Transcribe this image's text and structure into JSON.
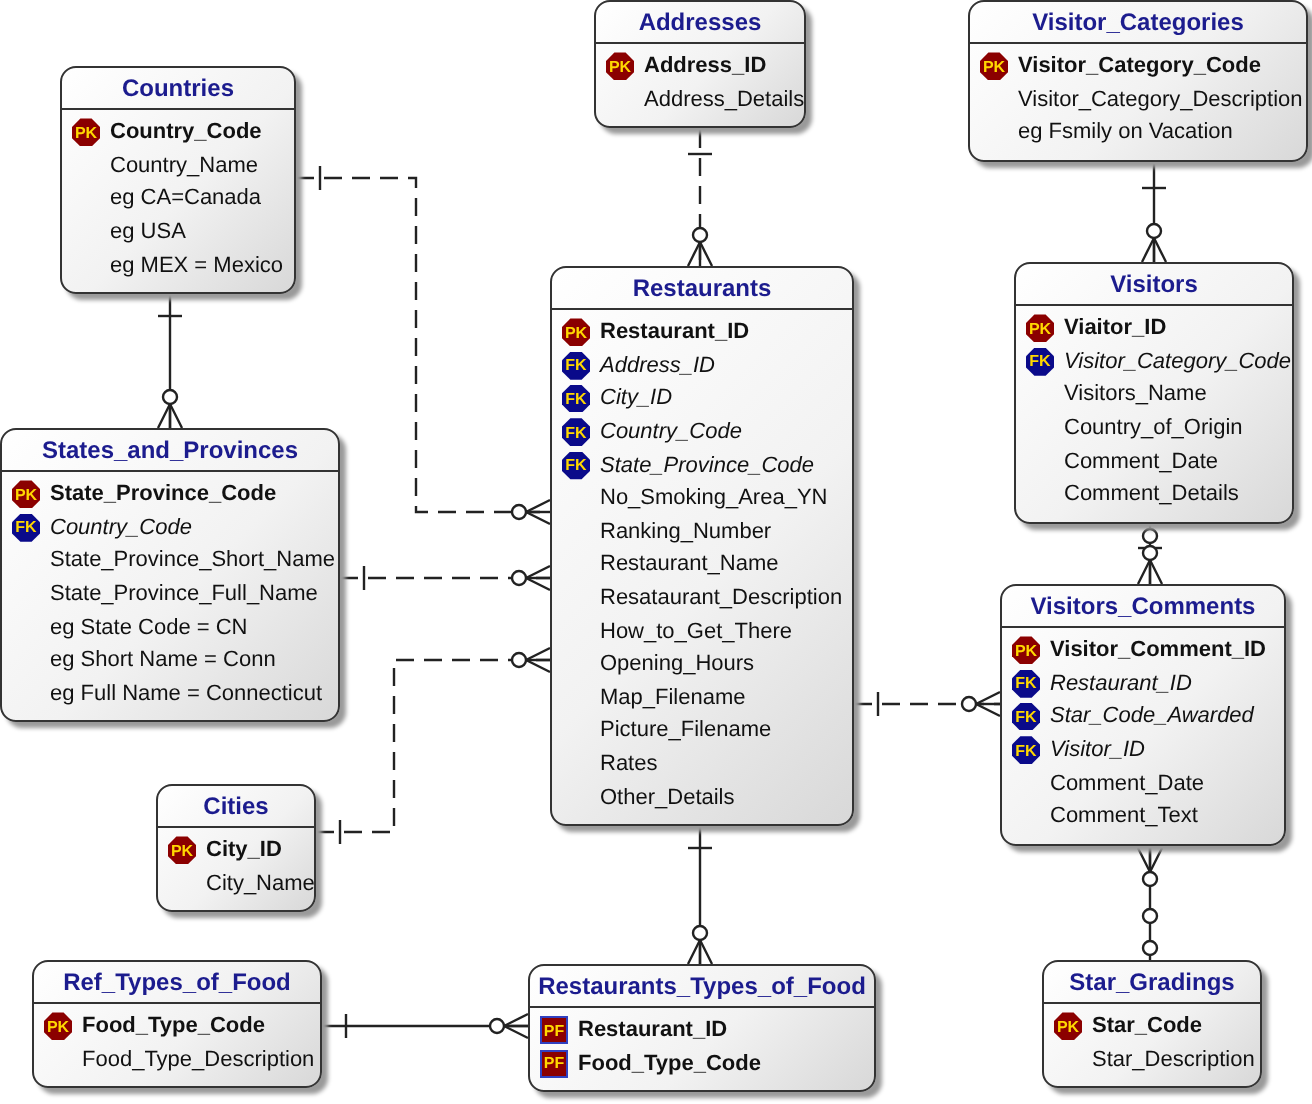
{
  "entities": [
    {
      "name": "Addresses",
      "fields": [
        {
          "name": "Address_ID",
          "kind": "primary",
          "badge": "PK"
        },
        {
          "name": "Address_Details",
          "kind": "plain"
        }
      ]
    },
    {
      "name": "Visitor_Categories",
      "fields": [
        {
          "name": "Visitor_Category_Code",
          "kind": "primary",
          "badge": "PK"
        },
        {
          "name": "Visitor_Category_Description",
          "kind": "plain"
        },
        {
          "name": "eg Fsmily on Vacation",
          "kind": "plain"
        }
      ]
    },
    {
      "name": "Countries",
      "fields": [
        {
          "name": "Country_Code",
          "kind": "primary",
          "badge": "PK"
        },
        {
          "name": "Country_Name",
          "kind": "plain"
        },
        {
          "name": "eg CA=Canada",
          "kind": "plain"
        },
        {
          "name": "eg USA",
          "kind": "plain"
        },
        {
          "name": "eg MEX = Mexico",
          "kind": "plain"
        }
      ]
    },
    {
      "name": "Restaurants",
      "fields": [
        {
          "name": "Restaurant_ID",
          "kind": "primary",
          "badge": "PK"
        },
        {
          "name": "Address_ID",
          "kind": "foreign",
          "badge": "FK"
        },
        {
          "name": "City_ID",
          "kind": "foreign",
          "badge": "FK"
        },
        {
          "name": "Country_Code",
          "kind": "foreign",
          "badge": "FK"
        },
        {
          "name": "State_Province_Code",
          "kind": "foreign",
          "badge": "FK"
        },
        {
          "name": "No_Smoking_Area_YN",
          "kind": "plain"
        },
        {
          "name": "Ranking_Number",
          "kind": "plain"
        },
        {
          "name": "Restaurant_Name",
          "kind": "plain"
        },
        {
          "name": "Resataurant_Description",
          "kind": "plain"
        },
        {
          "name": "How_to_Get_There",
          "kind": "plain"
        },
        {
          "name": "Opening_Hours",
          "kind": "plain"
        },
        {
          "name": "Map_Filename",
          "kind": "plain"
        },
        {
          "name": "Picture_Filename",
          "kind": "plain"
        },
        {
          "name": "Rates",
          "kind": "plain"
        },
        {
          "name": "Other_Details",
          "kind": "plain"
        }
      ]
    },
    {
      "name": "Visitors",
      "fields": [
        {
          "name": "Viaitor_ID",
          "kind": "primary",
          "badge": "PK"
        },
        {
          "name": "Visitor_Category_Code",
          "kind": "foreign",
          "badge": "FK"
        },
        {
          "name": "Visitors_Name",
          "kind": "plain"
        },
        {
          "name": "Country_of_Origin",
          "kind": "plain"
        },
        {
          "name": "Comment_Date",
          "kind": "plain"
        },
        {
          "name": "Comment_Details",
          "kind": "plain"
        }
      ]
    },
    {
      "name": "States_and_Provinces",
      "fields": [
        {
          "name": "State_Province_Code",
          "kind": "primary",
          "badge": "PK"
        },
        {
          "name": "Country_Code",
          "kind": "foreign",
          "badge": "FK"
        },
        {
          "name": "State_Province_Short_Name",
          "kind": "plain"
        },
        {
          "name": "State_Province_Full_Name",
          "kind": "plain"
        },
        {
          "name": "eg State Code = CN",
          "kind": "plain"
        },
        {
          "name": "eg Short Name = Conn",
          "kind": "plain"
        },
        {
          "name": "eg Full Name = Connecticut",
          "kind": "plain"
        }
      ]
    },
    {
      "name": "Visitors_Comments",
      "fields": [
        {
          "name": "Visitor_Comment_ID",
          "kind": "primary",
          "badge": "PK"
        },
        {
          "name": "Restaurant_ID",
          "kind": "foreign",
          "badge": "FK"
        },
        {
          "name": "Star_Code_Awarded",
          "kind": "foreign",
          "badge": "FK"
        },
        {
          "name": "Visitor_ID",
          "kind": "foreign",
          "badge": "FK"
        },
        {
          "name": "Comment_Date",
          "kind": "plain"
        },
        {
          "name": "Comment_Text",
          "kind": "plain"
        }
      ]
    },
    {
      "name": "Cities",
      "fields": [
        {
          "name": "City_ID",
          "kind": "primary",
          "badge": "PK"
        },
        {
          "name": "City_Name",
          "kind": "plain"
        }
      ]
    },
    {
      "name": "Ref_Types_of_Food",
      "fields": [
        {
          "name": "Food_Type_Code",
          "kind": "primary",
          "badge": "PK"
        },
        {
          "name": "Food_Type_Description",
          "kind": "plain"
        }
      ]
    },
    {
      "name": "Restaurants_Types_of_Food",
      "fields": [
        {
          "name": "Restaurant_ID",
          "kind": "primary_foreign",
          "badge": "PF"
        },
        {
          "name": "Food_Type_Code",
          "kind": "primary_foreign",
          "badge": "PF"
        }
      ]
    },
    {
      "name": "Star_Gradings",
      "fields": [
        {
          "name": "Star_Code",
          "kind": "primary",
          "badge": "PK"
        },
        {
          "name": "Star_Description",
          "kind": "plain"
        }
      ]
    }
  ]
}
